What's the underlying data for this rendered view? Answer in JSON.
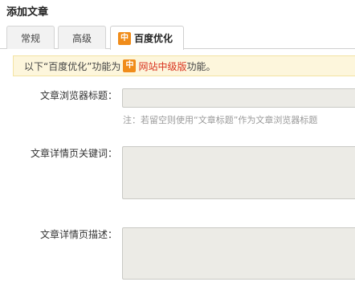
{
  "page": {
    "title": "添加文章"
  },
  "tabs": [
    {
      "label": "常规"
    },
    {
      "label": "高级"
    },
    {
      "label": "百度优化",
      "icon": "中",
      "active": true
    }
  ],
  "notice": {
    "before": "以下“百度优化”功能为",
    "icon": "中",
    "highlight": "网站中级版",
    "after": "功能。"
  },
  "form": {
    "browser_title": {
      "label": "文章浏览器标题：",
      "value": ""
    },
    "browser_title_hint": "注：若留空则使用“文章标题”作为文章浏览器标题",
    "keywords": {
      "label": "文章详情页关键词：",
      "value": ""
    },
    "description": {
      "label": "文章详情页描述：",
      "value": ""
    }
  },
  "colors": {
    "badge": "#f08c1a",
    "notice_bg": "#fdf6dc",
    "highlight": "#d9331f",
    "field_bg": "#ecebe6"
  }
}
